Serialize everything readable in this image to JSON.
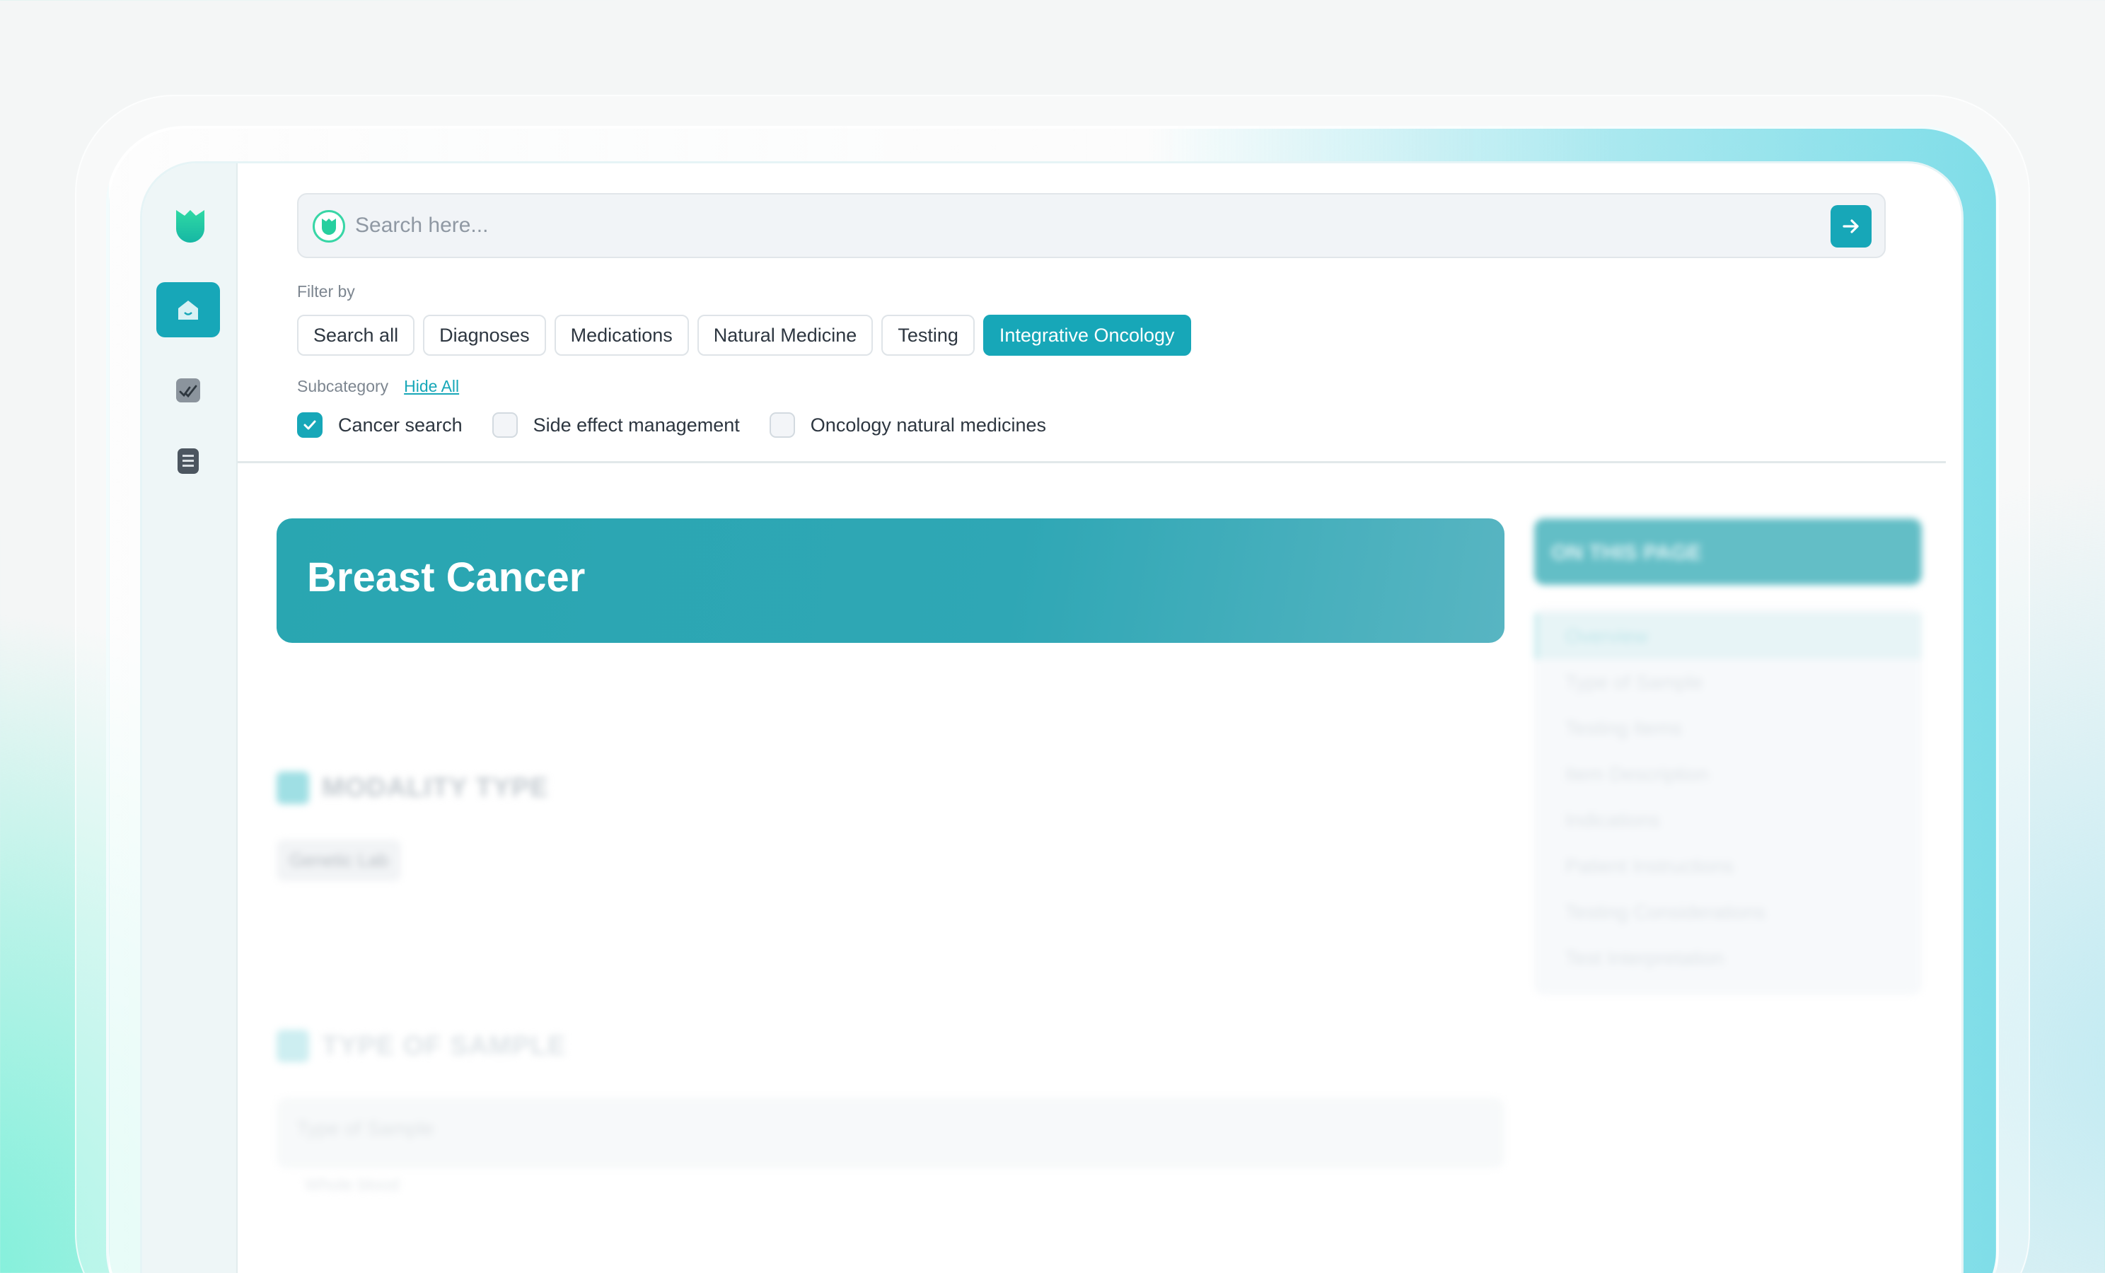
{
  "search": {
    "placeholder": "Search here..."
  },
  "filter": {
    "label": "Filter by",
    "chips": [
      {
        "label": "Search all",
        "active": false
      },
      {
        "label": "Diagnoses",
        "active": false
      },
      {
        "label": "Medications",
        "active": false
      },
      {
        "label": "Natural Medicine",
        "active": false
      },
      {
        "label": "Testing",
        "active": false
      },
      {
        "label": "Integrative Oncology",
        "active": true
      }
    ]
  },
  "subcategory": {
    "label": "Subcategory",
    "toggle_label": "Hide All",
    "options": [
      {
        "label": "Cancer search",
        "checked": true
      },
      {
        "label": "Side effect management",
        "checked": false
      },
      {
        "label": "Oncology natural medicines",
        "checked": false
      }
    ]
  },
  "hero": {
    "title": "Breast Cancer"
  },
  "sections": {
    "modality_title": "MODALITY TYPE",
    "modality_value": "Genetic Lab",
    "sample_title": "TYPE OF SAMPLE",
    "sample_label": "Type of Sample",
    "sample_value": "Whole blood"
  },
  "toc": {
    "title": "ON THIS PAGE",
    "items": [
      "Overview",
      "Type of Sample",
      "Testing Items",
      "Item Description",
      "Indications",
      "Patient Instructions",
      "Testing Considerations",
      "Test Interpretation"
    ]
  },
  "colors": {
    "accent": "#17a7b8",
    "brand_green": "#38d6a6",
    "hero_bg": "#2fa7b5"
  },
  "icons": {
    "sidebar": [
      "logo-icon",
      "home-icon",
      "check-icon",
      "document-icon"
    ],
    "search_go": "arrow-right-icon"
  }
}
